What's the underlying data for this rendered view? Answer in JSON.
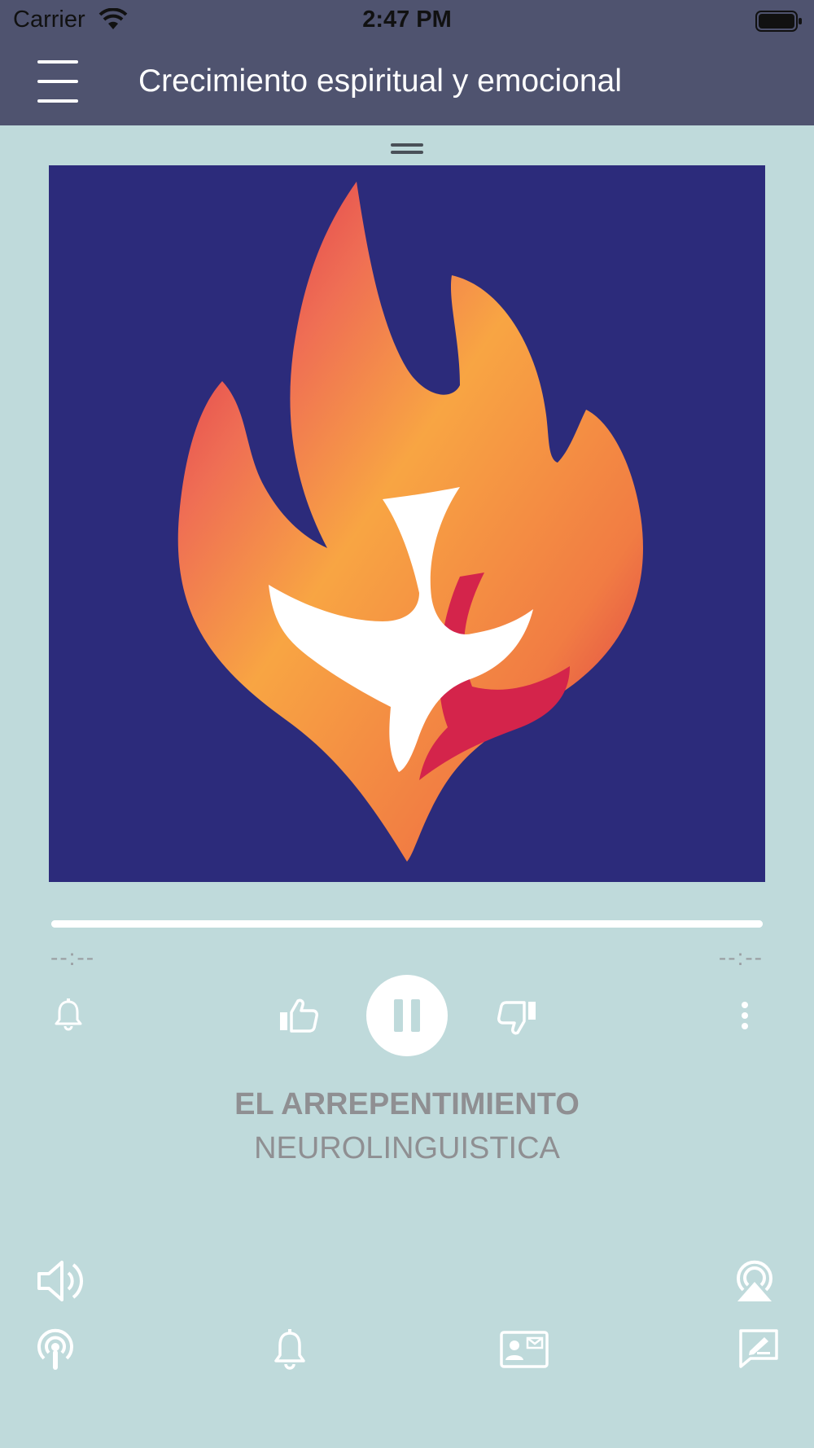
{
  "status_bar": {
    "carrier": "Carrier",
    "time": "2:47 PM"
  },
  "header": {
    "title": "Crecimiento espiritual y emocional"
  },
  "colors": {
    "header_bg": "#4f536f",
    "page_bg": "#bfdadb",
    "artwork_bg": "#2c2b7b",
    "text_muted": "#8f8f92"
  },
  "player": {
    "elapsed": "--:--",
    "remaining": "--:--",
    "progress": 1.0,
    "state": "playing",
    "track_title": "EL ARREPENTIMIENTO",
    "track_artist": "NEUROLINGUISTICA"
  },
  "icons": {
    "artwork": "flame-dove-logo",
    "row1": [
      "bell-icon",
      "thumbs-up-icon",
      "pause-icon",
      "thumbs-down-icon",
      "more-vertical-icon"
    ],
    "row2": [
      "volume-icon",
      "airplay-icon"
    ],
    "bottom_bar": [
      "podcast-icon",
      "bell-icon",
      "contact-card-icon",
      "compose-icon"
    ]
  }
}
